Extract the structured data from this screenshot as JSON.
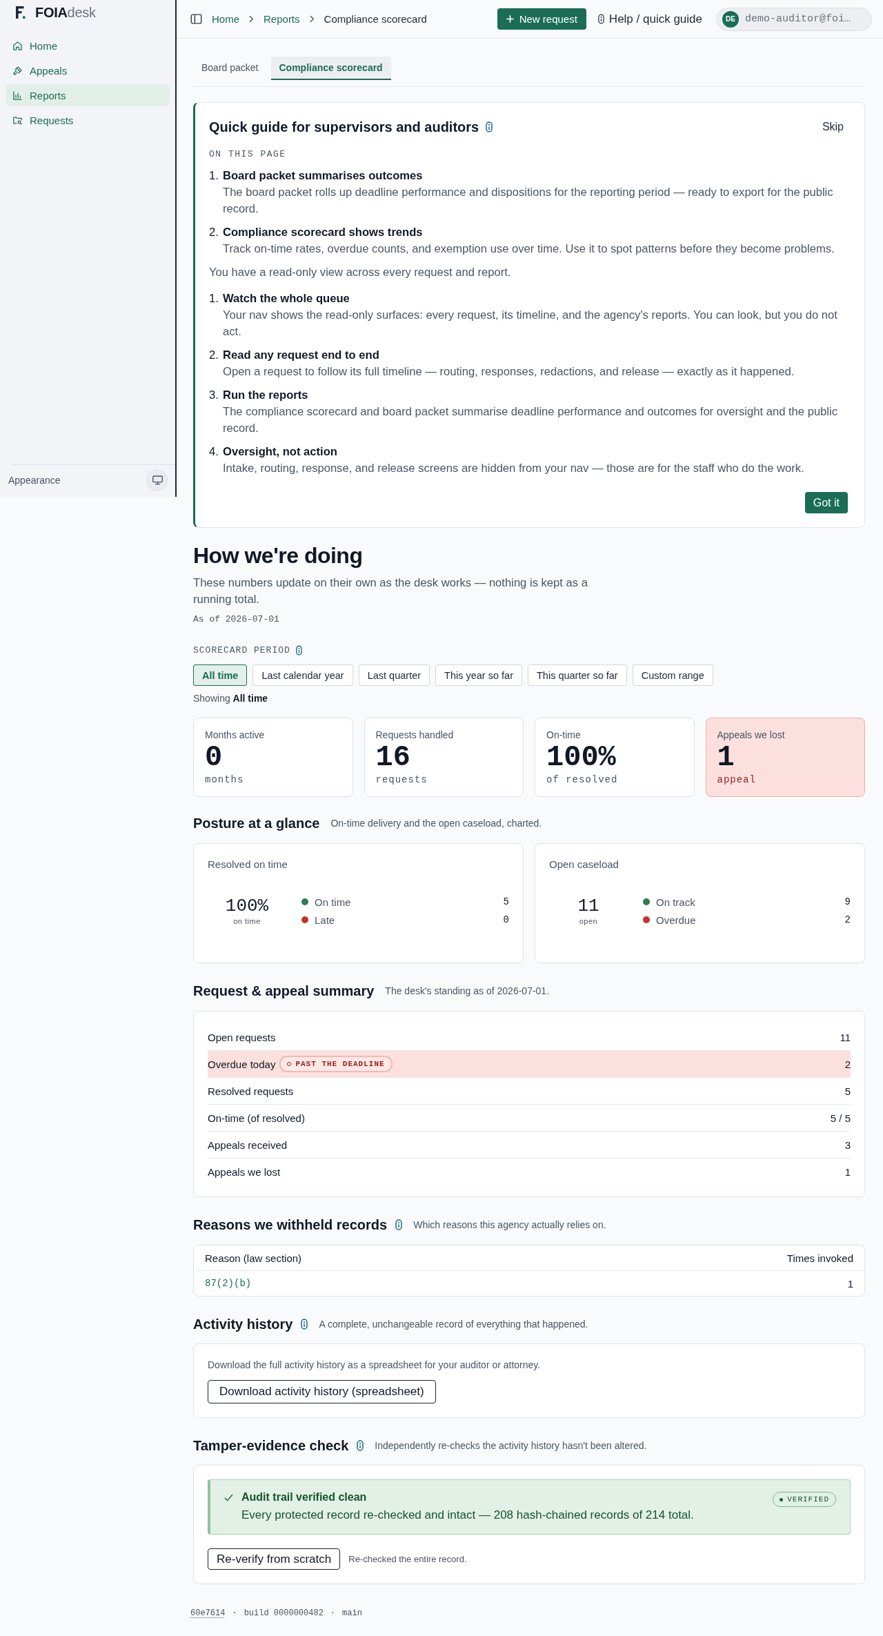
{
  "sidebar": {
    "logo": "**FOIA**desk",
    "items": [
      {
        "label": "Home",
        "selected": false
      },
      {
        "label": "Appeals",
        "selected": false
      },
      {
        "label": "Reports",
        "selected": true
      },
      {
        "label": "Requests",
        "selected": false
      }
    ],
    "appearance": "Appearance"
  },
  "header": {
    "breadcrumb": [
      {
        "label": "Home",
        "current": false
      },
      {
        "label": "Reports",
        "current": false
      },
      {
        "label": "Compliance scorecard",
        "current": true
      }
    ],
    "new_request": "New request",
    "help": "Help / quick guide",
    "user": {
      "initials": "DE",
      "email": "demo-auditor@foi…"
    }
  },
  "tabs": [
    {
      "label": "Board packet",
      "selected": false
    },
    {
      "label": "Compliance scorecard",
      "selected": true
    }
  ],
  "guide": {
    "title": "Quick guide for supervisors and auditors",
    "skip": "Skip",
    "section_label": "ON THIS PAGE",
    "page_steps": [
      {
        "number": "1.",
        "title": "Board packet summarises outcomes",
        "text": "The board packet rolls up deadline performance and dispositions for the reporting period — ready to export for the public record."
      },
      {
        "number": "2.",
        "title": "Compliance scorecard shows trends",
        "text": "Track on-time rates, overdue counts, and exemption use over time. Use it to spot patterns before they become problems."
      }
    ],
    "note": "You have a read-only view across every request and report.",
    "role_steps": [
      {
        "number": "1.",
        "title": "Watch the whole queue",
        "text": "Your nav shows the read-only surfaces: every request, its timeline, and the agency's reports. You can look, but you do not act."
      },
      {
        "number": "2.",
        "title": "Read any request end to end",
        "text": "Open a request to follow its full timeline — routing, responses, redactions, and release — exactly as it happened."
      },
      {
        "number": "3.",
        "title": "Run the reports",
        "text": "The compliance scorecard and board packet summarise deadline performance and outcomes for oversight and the public record."
      },
      {
        "number": "4.",
        "title": "Oversight, not action",
        "text": "Intake, routing, response, and release screens are hidden from your nav — those are for the staff who do the work."
      }
    ],
    "dismiss": "Got it"
  },
  "overview": {
    "title": "How we're doing",
    "intro": "These numbers update on their own as the desk works — nothing is kept as a running total.",
    "as_of": "As of 2026-07-01",
    "period": {
      "label": "SCORECARD PERIOD",
      "options": [
        {
          "label": "All time",
          "selected": true
        },
        {
          "label": "Last calendar year",
          "selected": false
        },
        {
          "label": "Last quarter",
          "selected": false
        },
        {
          "label": "This year so far",
          "selected": false
        },
        {
          "label": "This quarter so far",
          "selected": false
        },
        {
          "label": "Custom range",
          "selected": false
        }
      ],
      "showing": "Showing **All time**"
    },
    "stats": [
      {
        "label": "Months active",
        "value": "0",
        "unit": "months",
        "alert": false
      },
      {
        "label": "Requests handled",
        "value": "16",
        "unit": "requests",
        "alert": false
      },
      {
        "label": "On-time",
        "value": "100%",
        "unit": "of resolved",
        "alert": false
      },
      {
        "label": "Appeals we lost",
        "value": "1",
        "unit": "appeal",
        "alert": true
      }
    ]
  },
  "posture": {
    "title": "Posture at a glance",
    "subtitle": "On-time delivery and the open caseload, charted.",
    "cards": [
      {
        "title": "Resolved on time",
        "value": "100%",
        "caption": "on time",
        "legend": [
          {
            "label": "On time",
            "count": "5",
            "color": "#2e7d4f"
          },
          {
            "label": "Late",
            "count": "0",
            "color": "#c8312b"
          }
        ]
      },
      {
        "title": "Open caseload",
        "value": "11",
        "caption": "open",
        "legend": [
          {
            "label": "On track",
            "count": "9",
            "color": "#2e7d4f"
          },
          {
            "label": "Overdue",
            "count": "2",
            "color": "#c8312b"
          }
        ]
      }
    ]
  },
  "summary": {
    "title": "Request & appeal summary",
    "subtitle": "The desk's standing as of 2026-07-01.",
    "rows": [
      {
        "label": "Open requests",
        "value": "11",
        "flagged": false
      },
      {
        "label": "Overdue today",
        "badge": "PAST THE DEADLINE",
        "value": "2",
        "flagged": true
      },
      {
        "label": "Resolved requests",
        "value": "5",
        "flagged": false
      },
      {
        "label": "On-time (of resolved)",
        "value": "5 / 5",
        "flagged": false
      },
      {
        "label": "Appeals received",
        "value": "3",
        "flagged": false
      },
      {
        "label": "Appeals we lost",
        "value": "1",
        "flagged": false
      }
    ]
  },
  "exemptions": {
    "title": "Reasons we withheld records",
    "subtitle": "Which reasons this agency actually relies on.",
    "columns": [
      "Reason (law section)",
      "Times invoked"
    ],
    "rows": [
      {
        "reason": "87(2)(b)",
        "count": "1"
      }
    ]
  },
  "activity": {
    "title": "Activity history",
    "subtitle": "A complete, unchangeable record of everything that happened.",
    "text": "Download the full activity history as a spreadsheet for your auditor or attorney.",
    "button": "Download activity history (spreadsheet)"
  },
  "tamper": {
    "title": "Tamper-evidence check",
    "subtitle": "Independently re-checks the activity history hasn't been altered.",
    "alert": {
      "verified": true,
      "title": "Audit trail verified clean",
      "text": "Every protected record re-checked and intact — 208 hash-chained records of 214 total.",
      "badge": "VERIFIED"
    },
    "button": "Re-verify from scratch",
    "note": "Re-checked the entire record."
  },
  "footer": [
    {
      "kind": "commit",
      "text": "60e7614"
    },
    {
      "kind": "separator",
      "text": "·"
    },
    {
      "kind": "build",
      "text": "build 0000000482"
    },
    {
      "kind": "separator",
      "text": "·"
    },
    {
      "kind": "branch",
      "text": "main"
    }
  ]
}
